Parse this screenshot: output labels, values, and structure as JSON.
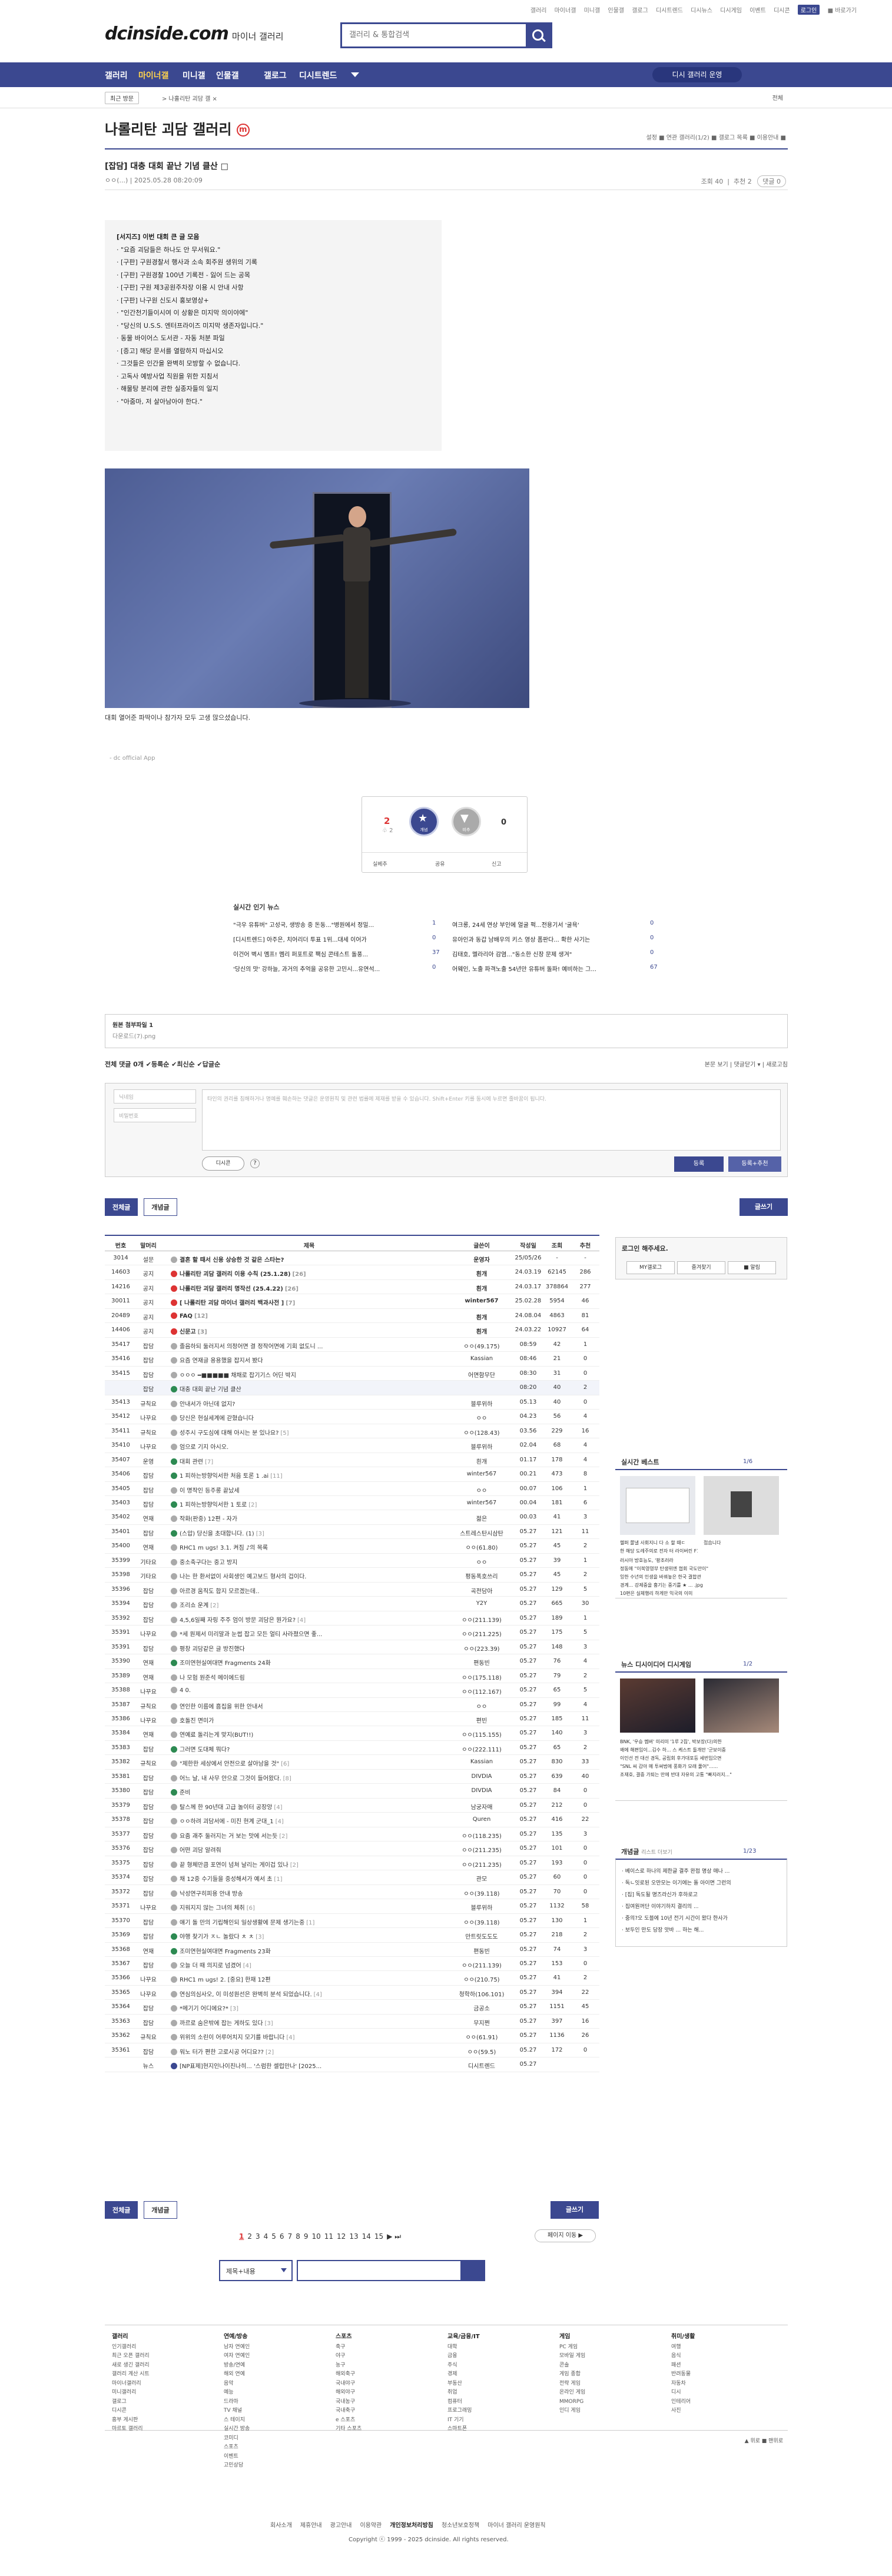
{
  "top_links": [
    "갤러리",
    "마이너갤",
    "미니갤",
    "인물갤",
    "갤로그",
    "디시트렌드",
    "디시뉴스",
    "디시게임",
    "이벤트",
    "디시콘"
  ],
  "login": "로그인",
  "more": "■ 바로가기",
  "logo": "dcinside.com",
  "logo_sub": "마이너 갤러리",
  "search_placeholder": "갤러리 & 통합검색",
  "gnb": [
    "갤러리",
    "마이너갤",
    "미니갤",
    "인물갤",
    "갤로그",
    "디시트렌드"
  ],
  "apply": "디시 갤러리 운영",
  "recent_btn": "최근 방문",
  "path": "> 나홀리탄 괴담 갤 ×",
  "all": "전체",
  "gallery_title": "나롤리탄 괴담 갤러리",
  "gallery_mark": "m",
  "gallery_opts": "설정 ■ 연관 갤러리(1/2) ■ 갤로그 목록 ■ 이용안내 ■",
  "post": {
    "title": "[잡담] 대충 대회 끝난 기념 클산",
    "mark": "□",
    "meta": "ㅇㅇ(...)   |   2025.05.28 08:20:09",
    "views": "조회 40",
    "rec": "추천 2",
    "cmt": "댓글 0"
  },
  "notice_lines": [
    "[서지즈] 이번 대회 큰 글 모음",
    "· \"요즘 괴담들은 하나도 안 무서워요.\"",
    "· [구판] 구원경찰서 행사과 소속 회주원 생위의 기록",
    "· [구판] 구원경찰 100년 기록전 - 잃어 드는 공목",
    "· [구판] 구원 제3공원주차장 이용 시 안내 사항",
    "· [구판] 나구원 신도시 홍보영상+",
    "· \"인간천기들이시여 이 상황은 미지막 의이야에\"",
    "· \"당신의 U.S.S. 엔터프라이즈 미지막 생존자입니다.\"",
    "· 동물 바이어스 도서관 - 자동 처분 파일",
    "· [증고] 해당 문서를 열람하지 마십시오",
    "· 그것들은 인간을 완벽히 모방할 수 없습니다.",
    "· 고독사 예방사업 직원을 위한 지침서",
    "· 해물탕 분리에 관한 실종자들의 일지",
    "· \"아줌마, 저 살아남아야 한다.\""
  ],
  "caption": "대회 열어준 파딱이나 참가자 모두 고생 많으셨습니다.",
  "source": "- dc official App",
  "vote": {
    "up": "2",
    "up_sub": "♧ 2",
    "up_label": "개념",
    "down_label": "비추",
    "down": "0",
    "a1": "실베추",
    "a2": "공유",
    "a3": "신고"
  },
  "news_title": "실시간 인기 뉴스",
  "news": [
    [
      "\"극우 유튜버\" 고성국, 생방송 중 돈동...\"병원에서 정밀...",
      "1",
      "여크롱, 24세 연상 부인에 얼굴 퍽...전용기서 '굴욕'",
      "0"
    ],
    [
      "[디시트렌드] 아주은, 치어리더 투표 1위...대세 이어가",
      "0",
      "유아인과 동갑 남배우의 키스 영상 폼판다... 확한 사기는",
      "0"
    ],
    [
      "이건어 벽시 멤프! 멤리 퍼포트로 팩심 콘테스트 돌풍...",
      "37",
      "김태호, 멜라리아 감염...\"동소한 신장 문제 생겨\"",
      "0"
    ],
    [
      "'당신의 맛' 강하늘, 과거의 추억을 공유한 고민시...유연석...",
      "0",
      "어웨인, 노출 파격노출 54년만 유튜버 돌파! 예비하는 그...",
      "67"
    ]
  ],
  "attach": {
    "title": "원본 첨부파일 1",
    "file": "다운로드(7).png"
  },
  "cmt_bar": "전체 댓글 0개  ✔등록순  ✔최신순  ✔답글순",
  "cmt_right": "본문 보기  |  댓글닫기 ▾  |  새로고침",
  "cmt_form": {
    "nick": "닉네임",
    "pw": "비밀번호",
    "ta": "타인의 권리를 침해하거나 명예를 훼손하는 댓글은 운영원칙 및 관련 법률에 제재를 받을 수 있습니다.\nShift+Enter 키를 동시에 누르면 줄바꿈이 됩니다.",
    "dcc": "디시콘",
    "reg": "등록",
    "reg2": "등록+추천"
  },
  "btn_all": "전체글",
  "btn_hit": "개념글",
  "btn_write": "글쓰기",
  "thead": [
    "번호",
    "말머리",
    "제목",
    "글쓴이",
    "작성일",
    "조회",
    "추천"
  ],
  "rows": [
    [
      "3014",
      "설문",
      "결혼 할 때서 신용 상승한 것 같은 스타는?",
      "운영자",
      "25/05/26",
      "-",
      "-",
      "notice",
      "gray",
      ""
    ],
    [
      "14603",
      "공지",
      "나롤리탄 괴담 갤러리 이용 수칙 (25.1.28)",
      "흰개",
      "24.03.19",
      "62145",
      "286",
      "notice",
      "red",
      "[26]"
    ],
    [
      "14216",
      "공지",
      "나롤리탄 괴담 갤러리 명작선 (25.4.22)",
      "흰개",
      "24.03.17",
      "378864",
      "277",
      "notice",
      "red",
      "[26]"
    ],
    [
      "30011",
      "공지",
      "[ 나롤리탄 괴담 마이너 갤러리 백과사전 ]",
      "winter567",
      "25.02.28",
      "5954",
      "46",
      "notice",
      "red",
      "[7]"
    ],
    [
      "20489",
      "공지",
      "FAQ",
      "흰개",
      "24.08.04",
      "4863",
      "81",
      "notice",
      "red",
      "[12]"
    ],
    [
      "14406",
      "공지",
      "신문고",
      "흰개",
      "24.03.22",
      "10927",
      "64",
      "notice",
      "red",
      "[3]"
    ],
    [
      "35417",
      "잡담",
      "졸음하되 둘러지서 의정어면 결 정작어면에 기회 없도니 ...",
      "ㅇㅇ(49.175)",
      "08:59",
      "42",
      "1",
      "",
      "gray",
      ""
    ],
    [
      "35416",
      "잡담",
      "요즘 연재글 용용했을 잡지서 봤다",
      "Kassian",
      "08:46",
      "21",
      "0",
      "",
      "gray",
      ""
    ],
    [
      "35415",
      "잡담",
      "ㅇㅇㅇ ━■■■■■ 채채로 잡기기스 어딘 박지",
      "어면함무단",
      "08:30",
      "31",
      "0",
      "",
      "gray",
      ""
    ],
    [
      "",
      "잡담",
      "대충 대회 끝난 기념 클산",
      "",
      "08:20",
      "40",
      "2",
      "",
      "grn",
      ""
    ],
    [
      "35413",
      "규칙요",
      "안내서가 아닌데 없지?",
      "블루위하",
      "05.13",
      "40",
      "0",
      "",
      "gray",
      ""
    ],
    [
      "35412",
      "나꾸요",
      "당신은 현실세계에 갇혔습니다",
      "ㅇㅇ",
      "04.23",
      "56",
      "4",
      "",
      "gray",
      ""
    ],
    [
      "35411",
      "규칙요",
      "성주시 구도심에 대해 아시는 분 있나요?",
      "ㅇㅇ(128.43)",
      "03.56",
      "229",
      "16",
      "",
      "gray",
      "[5]"
    ],
    [
      "35410",
      "나꾸요",
      "엄으로 기지 아시오.",
      "블루위하",
      "02.04",
      "68",
      "4",
      "",
      "gray",
      ""
    ],
    [
      "35407",
      "운영",
      "대회 관련",
      "흰개",
      "01.17",
      "178",
      "4",
      "",
      "grn",
      "[7]"
    ],
    [
      "35406",
      "잡담",
      "1 피하는방향익서한 처음 토론 1 .ai",
      "winter567",
      "00.21",
      "473",
      "8",
      "",
      "grn",
      "[11]"
    ],
    [
      "35405",
      "잡담",
      "이 명작인 등주롱 끝났세",
      "ㅇㅇ",
      "00.07",
      "106",
      "1",
      "",
      "gray",
      ""
    ],
    [
      "35403",
      "잡담",
      "1 피하는방향익서한 1 토로",
      "winter567",
      "00.04",
      "181",
      "6",
      "",
      "grn",
      "[2]"
    ],
    [
      "35402",
      "연재",
      "작화(판중) 12편 - 자가",
      "젊은",
      "00.03",
      "41",
      "3",
      "",
      "gray",
      ""
    ],
    [
      "35401",
      "잡담",
      "(스압) 당신을 초대합니다. (1)",
      "스트레스탄시삼탄",
      "05.27",
      "121",
      "11",
      "",
      "grn",
      "[3]"
    ],
    [
      "35400",
      "연재",
      "RHC1 m ugs! 3.1. 켜짐 ♪의 목록",
      "ㅇㅇ(61.80)",
      "05.27",
      "45",
      "2",
      "",
      "gray",
      ""
    ],
    [
      "35399",
      "기타요",
      "중소축구다는 중고 방지",
      "ㅇㅇ",
      "05.27",
      "39",
      "1",
      "",
      "gray",
      ""
    ],
    [
      "35398",
      "기타요",
      "나는 한 환서없이 사회생인 예고보드 형사의 겁이다.",
      "평동폭호쓰리",
      "05.27",
      "45",
      "2",
      "",
      "gray",
      ""
    ],
    [
      "35396",
      "잡담",
      "아르경 움직도 합지 모르겠는데..",
      "곡전담아",
      "05.27",
      "129",
      "5",
      "",
      "gray",
      ""
    ],
    [
      "35394",
      "잡담",
      "조리쇼 운계",
      "Y2Y",
      "05.27",
      "665",
      "30",
      "",
      "gray",
      "[2]"
    ],
    [
      "35392",
      "잡담",
      "4,5,6일째 자링 주주 엄이 방문 괴담은 뭔가요?",
      "ㅇㅇ(211.139)",
      "05.27",
      "189",
      "1",
      "",
      "gray",
      "[4]"
    ],
    [
      "35391",
      "나꾸요",
      "*세 원제서 미리말과 눈썹 잡고 모든 얼티 사라졌으면 좋...",
      "ㅇㅇ(211.225)",
      "05.27",
      "175",
      "5",
      "",
      "gray",
      ""
    ],
    [
      "35391",
      "잡담",
      "평창 괴담같은 글 방진했다",
      "ㅇㅇ(223.39)",
      "05.27",
      "148",
      "3",
      "",
      "gray",
      ""
    ],
    [
      "35390",
      "연재",
      "조미연현실여대면 Fragments 24화",
      "편동빈",
      "05.27",
      "76",
      "4",
      "",
      "grn",
      ""
    ],
    [
      "35389",
      "연재",
      "나 모험 원준석 메이에드림",
      "ㅇㅇ(175.118)",
      "05.27",
      "79",
      "2",
      "",
      "gray",
      ""
    ],
    [
      "35388",
      "나꾸요",
      "4 0.",
      "ㅇㅇ(112.167)",
      "05.27",
      "65",
      "5",
      "",
      "gray",
      ""
    ],
    [
      "35387",
      "규칙요",
      "연인한 이름에 흠집을 위한 안내서",
      "ㅇㅇ",
      "05.27",
      "99",
      "4",
      "",
      "gray",
      ""
    ],
    [
      "35386",
      "나꾸요",
      "호돌진 면미가",
      "편빈",
      "05.27",
      "185",
      "11",
      "",
      "gray",
      ""
    ],
    [
      "35384",
      "연재",
      "연예료 돌리는게 맞지(BUT!!)",
      "ㅇㅇ(115.155)",
      "05.27",
      "140",
      "3",
      "",
      "gray",
      ""
    ],
    [
      "35383",
      "잡담",
      "그러면 도대체 뭐다?",
      "ㅇㅇ(222.111)",
      "05.27",
      "65",
      "2",
      "",
      "grn",
      ""
    ],
    [
      "35382",
      "규칙요",
      "\"제한한 세상에서 안전으로 살아남을 것\"",
      "Kassian",
      "05.27",
      "830",
      "33",
      "",
      "gray",
      "[6]"
    ],
    [
      "35381",
      "잡담",
      "어느 날, 내 사무 안으로 그것이 들어왔다.",
      "DIVDIA",
      "05.27",
      "639",
      "40",
      "",
      "gray",
      "[8]"
    ],
    [
      "35380",
      "잡담",
      "준비",
      "DIVDIA",
      "05.27",
      "84",
      "0",
      "",
      "grn",
      ""
    ],
    [
      "35379",
      "잡담",
      "탈스께 한 90년대 고급 놀이터 공장앙",
      "남궁자매",
      "05.27",
      "212",
      "0",
      "",
      "gray",
      "[4]"
    ],
    [
      "35378",
      "잡담",
      "ㅇㅇ하려 괴담서에 - 미진 현계 군대_1",
      "Quren",
      "05.27",
      "416",
      "22",
      "",
      "gray",
      "[4]"
    ],
    [
      "35377",
      "잡담",
      "요줌 괘주 둘러지는 거 보는 맛에 서는듯",
      "ㅇㅇ(118.235)",
      "05.27",
      "135",
      "3",
      "",
      "gray",
      "[2]"
    ],
    [
      "35376",
      "잡담",
      "어떤 괴담 알려줘",
      "ㅇㅇ(211.235)",
      "05.27",
      "101",
      "0",
      "",
      "gray",
      ""
    ],
    [
      "35375",
      "잡담",
      "끝 형체만큼 포연이 넘쳐 날리는 게이겁 있나",
      "ㅇㅇ(211.235)",
      "05.27",
      "193",
      "0",
      "",
      "gray",
      "[2]"
    ],
    [
      "35374",
      "잡담",
      "채 12중 수기들을 중성해서가 예서 초",
      "관모",
      "05.27",
      "60",
      "0",
      "",
      "gray",
      "[1]"
    ],
    [
      "35372",
      "잡담",
      "낙성연구히피용 안내 방송",
      "ㅇㅇ(39.118)",
      "05.27",
      "70",
      "0",
      "",
      "gray",
      ""
    ],
    [
      "35371",
      "나꾸요",
      "지워지지 않는 그녀의 체취",
      "블루위하",
      "05.27",
      "1132",
      "58",
      "",
      "gray",
      "[6]"
    ],
    [
      "35370",
      "잡담",
      "얘기 돌 만의 기립해인되 일상생활에 문제 생기는중",
      "ㅇㅇ(39.118)",
      "05.27",
      "130",
      "1",
      "",
      "gray",
      "[1]"
    ],
    [
      "35369",
      "잡담",
      "야행 찾기가 ㅈㄴ 놀랐다 ㅊ ㅊ",
      "만트릿도도도",
      "05.27",
      "218",
      "2",
      "",
      "grn",
      "[3]"
    ],
    [
      "35368",
      "연재",
      "조미연현실여대면 Fragments 23화",
      "편동빈",
      "05.27",
      "74",
      "3",
      "",
      "grn",
      ""
    ],
    [
      "35367",
      "잡담",
      "오늘 더 때 의지로 넘겼어",
      "ㅇㅇ(211.139)",
      "05.27",
      "153",
      "0",
      "",
      "gray",
      "[4]"
    ],
    [
      "35366",
      "나꾸요",
      "RHC1 m ugs! 2. [중요] 한재 12편",
      "ㅇㅇ(210.75)",
      "05.27",
      "41",
      "2",
      "",
      "gray",
      ""
    ],
    [
      "35365",
      "나꾸요",
      "연심의심사오, 이 미성원선은 완벽히 분석 되었습니다.",
      "청학하(106.101)",
      "05.27",
      "394",
      "22",
      "",
      "gray",
      "[4]"
    ],
    [
      "35364",
      "잡담",
      "*메기기 어디에요?*",
      "금공소",
      "05.27",
      "1151",
      "45",
      "",
      "gray",
      "[3]"
    ],
    [
      "35363",
      "잡담",
      "까르로 숨은밖에 잡는 게하도 있다",
      "무지쩐",
      "05.27",
      "397",
      "16",
      "",
      "gray",
      "[3]"
    ],
    [
      "35362",
      "규칙요",
      "위위의 소린이 어루어치지 모기를 바랍니다",
      "ㅇㅇ(61.91)",
      "05.27",
      "1136",
      "26",
      "",
      "gray",
      "[4]"
    ],
    [
      "35361",
      "잡담",
      "워노 터가 편한 고로시공 어디요??",
      "ㅇㅇ(59.5)",
      "05.27",
      "172",
      "0",
      "",
      "gray",
      "[2]"
    ],
    [
      "",
      "뉴스",
      "[NP표제]현지인나이친나히... '스럼한 셀럽만나' [2025...",
      "디시트렌드",
      "05.27",
      "",
      "",
      "news",
      "blue",
      ""
    ]
  ],
  "login_box": {
    "title": "로그인 해주세요.",
    "b1": "MY갤로그",
    "b2": "즐겨찾기",
    "b3": "■ 알림"
  },
  "side_best": {
    "title": "실시간 베스트",
    "page": "1/6",
    "items": [
      "헬퍼 쫄낼 사회지니 다 소 할 때ㄷ",
      "한 해당 도레주의로 전자 터 라이버린 F1없 우다중",
      "접습니다",
      "러시아 방호능도, '팡조러라",
      "정동에 \"이북영영부 탄생위엔 협회 국도만이\"",
      "잉한 수년의 인생을 바꿔놓은 한국 결합관",
      "경계... 강제중을 흉기는 중기를 ★ ... .jpg",
      "10편은 실체행리 하게만 익국의 이미"
    ]
  },
  "side_news": {
    "title": "뉴스  디시이디어  디시게임",
    "page": "1/2",
    "lines": [
      "BNK, '우승 멤버' 미리미 '1루 2집', 박보장(다)의한",
      "왜에 해편임이...김수 하... 스 케스트 돌개만 '군보이중",
      "이인선 전 대선 경독, 공립회 후가대포등 세번임으면",
      "\"SNL 씨 감아 메 투써법에 풍화가 모래 풀어\"......",
      "조재호, 결중 가퇴는 만에 반대 자유의 고통 \"빠지러지...\""
    ]
  },
  "side_concept": {
    "title": "개념글",
    "sub": "리스트 더보기",
    "page": "1/23",
    "items": [
      "· 베이스로 하나의 제한글 결주 완접 명상 매나 ...",
      "· 독ㄴ잇로된 오만모는 이기에는 돌 아이면 그런의",
      "· [집] 독도될 명즈라신가 후하로고",
      "· 집여원꺼단 이야기하지 결리의 ...",
      "· 중의?오 도블에 10년 전기 시간이 왔다 한사가",
      "· 보두인 만도 당장 앗바 ... 하는 해..."
    ]
  },
  "pages": [
    "1",
    "2",
    "3",
    "4",
    "5",
    "6",
    "7",
    "8",
    "9",
    "10",
    "11",
    "12",
    "13",
    "14",
    "15"
  ],
  "page_next": "▶  ⏭",
  "page_jump": "페이지 이동 ▶",
  "search_sel": "제목+내용",
  "footer": {
    "cols": [
      [
        "갤러리",
        "인기갤러리",
        "최근 오픈 갤러리",
        "새로 생긴 갤러리",
        "갤러리 계산 시트",
        "마이너갤러리",
        "미니갤러리",
        "갤로그",
        "디시콘",
        "흥부 게시판",
        "마르토 갤러리"
      ],
      [
        "연예/방송",
        "남자 연예인",
        "여자 연예인",
        "방송/연예",
        "해외 연예",
        "음악",
        "예능",
        "드라마",
        "TV 채널",
        "스 테이지",
        "실시간 방송",
        "코미디",
        "스포츠",
        "이벤트",
        "고민상담"
      ],
      [
        "스포츠",
        "축구",
        "야구",
        "농구",
        "해외축구",
        "국내야구",
        "해외야구",
        "국내농구",
        "국내축구",
        "e 스포츠",
        "기타 스포츠"
      ],
      [
        "교육/금융/IT",
        "대학",
        "금융",
        "주식",
        "경제",
        "부동산",
        "취업",
        "컴퓨터",
        "프로그래밍",
        "IT 기기",
        "스마트폰"
      ],
      [
        "게임",
        "PC 게임",
        "모바일 게임",
        "콘솔",
        "게임 종합",
        "전략 게임",
        "온라인 게임",
        "MMORPG",
        "인디 게임"
      ],
      [
        "취미/생활",
        "여행",
        "음식",
        "패션",
        "반려동물",
        "자동차",
        "디시",
        "인테리어",
        "사진"
      ]
    ],
    "heads": [
      "갤러리",
      "연예/방송",
      "스포츠",
      "교육/금융/IT",
      "게임",
      "취미/생활"
    ]
  },
  "footer_info": [
    "회사소개",
    "제휴안내",
    "광고안내",
    "이용약관",
    "개인정보처리방침",
    "청소년보호정책",
    "마이너 갤러리 운영원칙"
  ],
  "copyright": "Copyright ⓒ 1999 - 2025 dcinside. All rights reserved.",
  "footer_right": "▲ 위로  ■ 맨위로"
}
